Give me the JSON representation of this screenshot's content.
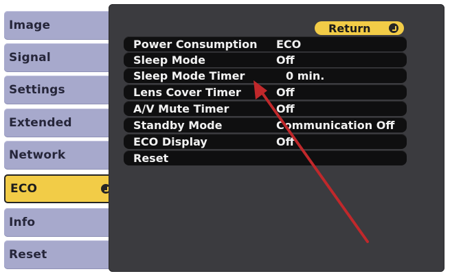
{
  "sidebar": {
    "items": [
      {
        "label": "Image"
      },
      {
        "label": "Signal"
      },
      {
        "label": "Settings"
      },
      {
        "label": "Extended"
      },
      {
        "label": "Network"
      },
      {
        "label": "ECO",
        "active": true
      },
      {
        "label": "Info"
      },
      {
        "label": "Reset"
      }
    ]
  },
  "header": {
    "return_label": "Return"
  },
  "settings": {
    "rows": [
      {
        "label": "Power Consumption",
        "value": "ECO"
      },
      {
        "label": "Sleep Mode",
        "value": "Off"
      },
      {
        "label": "Sleep Mode Timer",
        "value": "0 min."
      },
      {
        "label": "Lens Cover Timer",
        "value": "Off"
      },
      {
        "label": "A/V Mute Timer",
        "value": "Off"
      },
      {
        "label": "Standby Mode",
        "value": "Communication Off"
      },
      {
        "label": "ECO Display",
        "value": "Off"
      },
      {
        "label": "Reset",
        "value": ""
      }
    ]
  },
  "colors": {
    "menu_bg": "#a7a9cc",
    "active_bg": "#f2cc47",
    "panel_bg": "#3b3b3f",
    "row_bg": "#0f0f10",
    "annotation_arrow": "#c0282b"
  },
  "icons": {
    "enter": "enter-icon",
    "annotation": "red-arrow-icon"
  }
}
